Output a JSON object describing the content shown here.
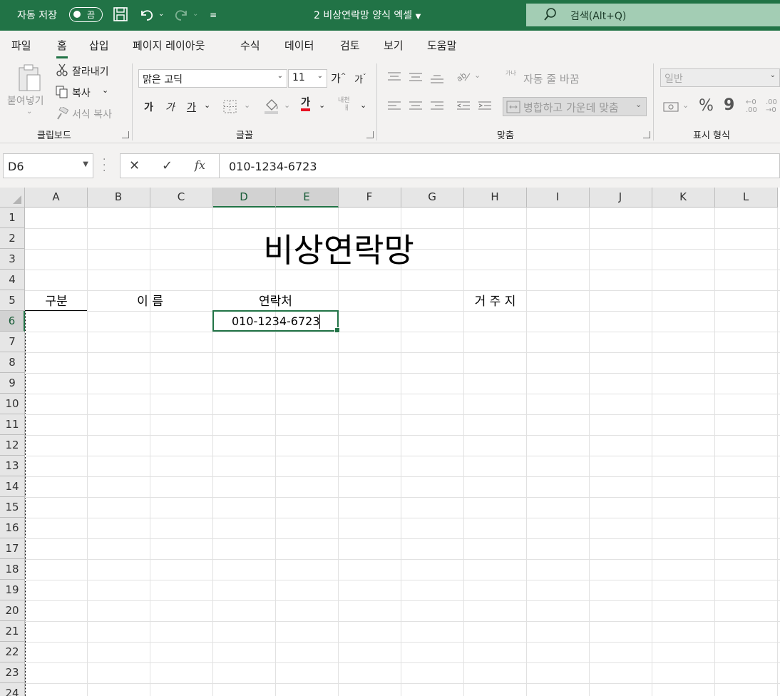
{
  "titlebar": {
    "autosave_label": "자동 저장",
    "autosave_state": "끔",
    "doc_title": "2 비상연락망 양식 엑셀",
    "search_placeholder": "검색(Alt+Q)"
  },
  "tabs": [
    "파일",
    "홈",
    "삽입",
    "페이지 레이아웃",
    "수식",
    "데이터",
    "검토",
    "보기",
    "도움말"
  ],
  "ribbon": {
    "clipboard": {
      "paste": "붙여넣기",
      "cut": "잘라내기",
      "copy": "복사",
      "format_painter": "서식 복사",
      "group": "클립보드"
    },
    "font": {
      "name": "맑은 고딕",
      "size": "11",
      "grow": "가",
      "shrink": "가",
      "bold": "가",
      "italic": "가",
      "underline": "가",
      "font_color": "가",
      "phonetic_top": "내천",
      "phonetic_bottom": "ㅐ",
      "group": "글꼴"
    },
    "alignment": {
      "wrap_text": "자동 줄 바꿈",
      "wrap_icon_text": "가나",
      "merge_center": "병합하고 가운데 맞춤",
      "group": "맞춤"
    },
    "number": {
      "format": "일반",
      "percent": "%",
      "comma": "9",
      "dec_inc": "←0 .00",
      "dec_dec": ".00 →0",
      "group": "표시 형식"
    }
  },
  "formula_bar": {
    "name_box": "D6",
    "cancel": "✕",
    "enter": "✓",
    "fx": "fx",
    "value": "010-1234-6723"
  },
  "sheet": {
    "columns": [
      "A",
      "B",
      "C",
      "D",
      "E",
      "F",
      "G",
      "H",
      "I",
      "J",
      "K",
      "L"
    ],
    "rows": [
      "1",
      "2",
      "3",
      "4",
      "5",
      "6",
      "7",
      "8",
      "9",
      "10",
      "11",
      "12",
      "13",
      "14",
      "15",
      "16",
      "17",
      "18",
      "19",
      "20",
      "21",
      "22",
      "23",
      "24"
    ],
    "selected_column_labels": [
      "D",
      "E"
    ],
    "selected_row": "6",
    "title": "비상연락망",
    "headers": {
      "category": "구분",
      "name": "이    름",
      "contact": "연락처",
      "address": "거    주    지"
    },
    "d6_value": "010-1234-6723"
  },
  "colors": {
    "excel_green": "#217346",
    "search_box": "#a3cdb4",
    "ribbon_bg": "#f3f2f1"
  }
}
